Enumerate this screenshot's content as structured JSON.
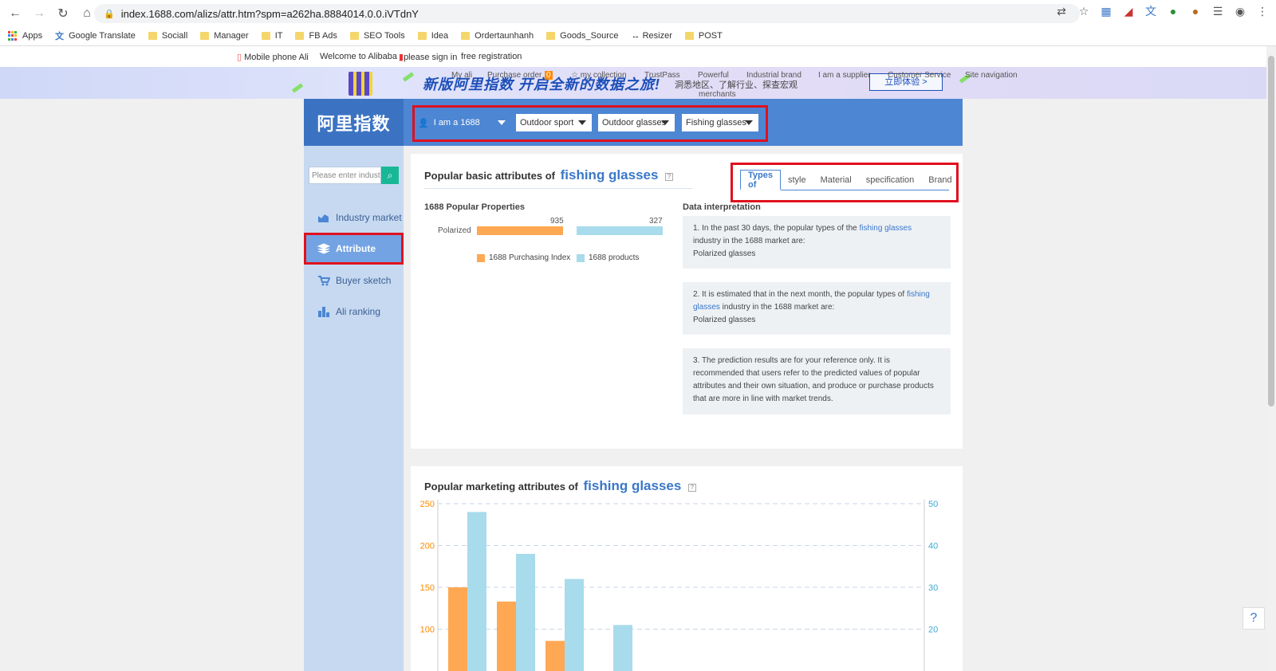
{
  "browser": {
    "url": "index.1688.com/alizs/attr.htm?spm=a262ha.8884014.0.0.iVTdnY",
    "bookmarks": [
      "Apps",
      "Google Translate",
      "Sociall",
      "Manager",
      "IT",
      "FB Ads",
      "SEO Tools",
      "Idea",
      "Ordertaunhanh",
      "Goods_Source",
      "↔ Resizer",
      "POST"
    ]
  },
  "topbar": {
    "mobile": "Mobile phone Ali",
    "welcome": "Welcome to Alibaba",
    "signin": "please sign in",
    "register": "free registration",
    "nav": [
      "My ali",
      "Purchase order",
      "0",
      "my collection",
      "TrustPass",
      "Powerful",
      "Industrial brand",
      "I am a supplier",
      "Customer Service",
      "Site navigation"
    ],
    "merchants": "merchants"
  },
  "banner": {
    "headline": "新版阿里指数 开启全新的数据之旅!",
    "sub": "洞悉地区、了解行业、探查宏观",
    "cta": "立即体验 >"
  },
  "header": {
    "logo": "阿里指数",
    "role": "I am a 1688",
    "dropdowns": [
      "Outdoor sport",
      "Outdoor glasses",
      "Fishing glasses"
    ]
  },
  "sidebar": {
    "search_placeholder": "Please enter indust",
    "items": [
      "Industry market",
      "Attribute",
      "Buyer sketch",
      "Ali ranking"
    ]
  },
  "panel1": {
    "title_prefix": "Popular basic attributes of",
    "keyword": "fishing glasses",
    "tabs": [
      "Types of",
      "style",
      "Material",
      "specification",
      "Brand"
    ],
    "subtitle": "1688 Popular Properties",
    "bar": {
      "label": "Polarized",
      "index_value": "935",
      "products_value": "327"
    },
    "legend": [
      "1688 Purchasing Index",
      "1688 products"
    ],
    "interp_title": "Data interpretation",
    "interp": [
      {
        "pre": "1. In the past 30 days, the popular types of the ",
        "kw": "fishing glasses",
        "post": " industry in the 1688 market are:",
        "last": "Polarized glasses"
      },
      {
        "pre": "2. It is estimated that in the next month, the popular types of ",
        "kw": "fishing glasses",
        "post": " industry in the 1688 market are:",
        "last": "Polarized glasses"
      },
      {
        "pre": "3. The prediction results are for your reference only. It is recommended that users refer to the predicted values of popular attributes and their own situation, and produce or purchase products that are more in line with market trends.",
        "kw": "",
        "post": "",
        "last": ""
      }
    ]
  },
  "panel2": {
    "title_prefix": "Popular marketing attributes of",
    "keyword": "fishing glasses"
  },
  "colors": {
    "orange": "#ffa854",
    "blue": "#a8dbeb",
    "accent": "#3b78c9",
    "highlight": "#e0101e"
  },
  "chart_data": {
    "type": "bar",
    "title": "",
    "left_ticks": [
      100,
      150,
      200,
      250
    ],
    "right_ticks": [
      20,
      30,
      40,
      50
    ],
    "left_ylim": [
      50,
      250
    ],
    "right_ylim": [
      10,
      50
    ],
    "series": [
      {
        "axis": "left",
        "color": "#ffa854",
        "values": [
          150,
          133,
          86,
          null
        ]
      },
      {
        "axis": "right",
        "color": "#a8dbeb",
        "values": [
          48,
          38,
          32,
          21
        ]
      }
    ]
  },
  "help": "?"
}
